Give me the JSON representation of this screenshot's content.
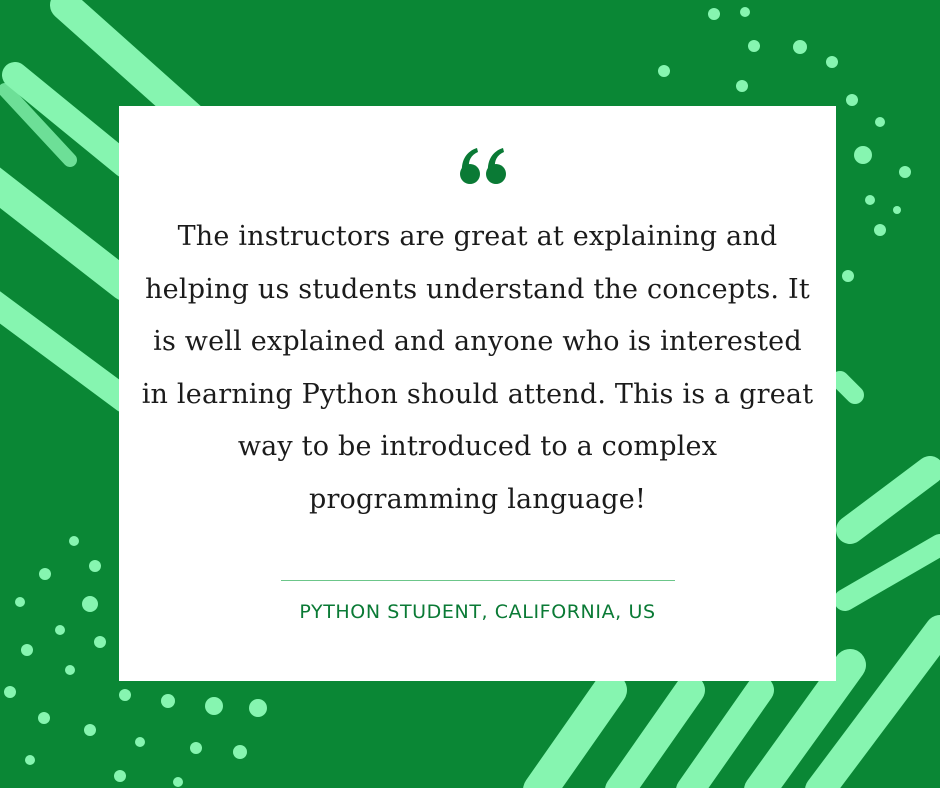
{
  "testimonial": {
    "quote": "The instructors are great at explaining and helping us students understand the concepts. It is well explained and anyone who is interested in learning Python should attend. This is a great way to be introduced to a complex programming language!",
    "attribution": "PYTHON STUDENT, CALIFORNIA, US"
  },
  "colors": {
    "background": "#0a8735",
    "accent": "#86f5b0",
    "card": "#ffffff",
    "quote_mark": "#0a7a35"
  },
  "icons": [
    "quote-mark-icon"
  ]
}
